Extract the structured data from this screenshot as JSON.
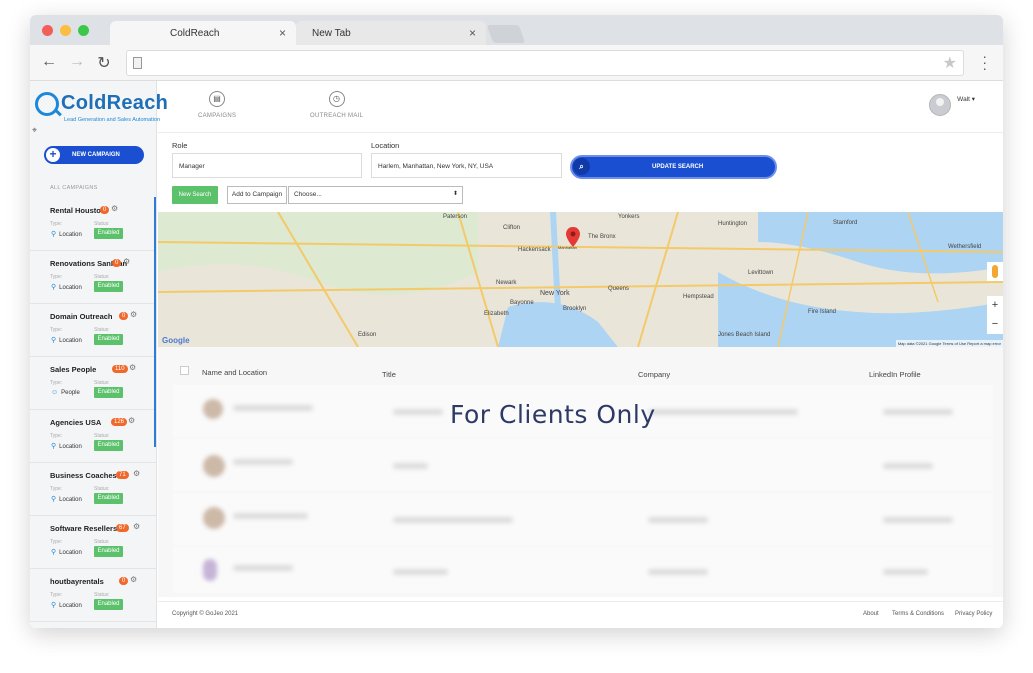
{
  "browser": {
    "tabs": [
      {
        "label": "ColdReach",
        "active": true
      },
      {
        "label": "New Tab",
        "active": false
      }
    ],
    "close_icon": "×",
    "nav": {
      "back": "←",
      "forward": "→",
      "reload": "↻"
    },
    "address": "",
    "star_icon": "bookmark-star-icon",
    "menu_icon": "kebab-menu-icon"
  },
  "app": {
    "logo": {
      "name": "ColdReach",
      "tagline": "Lead Generation and Sales Automation"
    },
    "new_campaign": "NEW CAMPAIGN",
    "all_campaigns": "ALL CAMPAIGNS",
    "campaigns": [
      {
        "name": "Rental Houston",
        "badge": "0",
        "type_label": "Type:",
        "status_label": "Status:",
        "type": "Location",
        "status": "Enabled"
      },
      {
        "name": "Renovations SanFran",
        "badge": "0",
        "type_label": "Type:",
        "status_label": "Status:",
        "type": "Location",
        "status": "Enabled"
      },
      {
        "name": "Domain Outreach",
        "badge": "0",
        "type_label": "Type:",
        "status_label": "Status:",
        "type": "Location",
        "status": "Enabled"
      },
      {
        "name": "Sales People",
        "badge": "110",
        "type_label": "Type:",
        "status_label": "Status:",
        "type": "People",
        "status": "Enabled"
      },
      {
        "name": "Agencies USA",
        "badge": "126",
        "type_label": "Type:",
        "status_label": "Status:",
        "type": "Location",
        "status": "Enabled"
      },
      {
        "name": "Business Coaches",
        "badge": "71",
        "type_label": "Type:",
        "status_label": "Status:",
        "type": "Location",
        "status": "Enabled"
      },
      {
        "name": "Software Resellers",
        "badge": "67",
        "type_label": "Type:",
        "status_label": "Status:",
        "type": "Location",
        "status": "Enabled"
      },
      {
        "name": "houtbayrentals",
        "badge": "0",
        "type_label": "Type:",
        "status_label": "Status:",
        "type": "Location",
        "status": "Enabled"
      }
    ],
    "topnav": [
      {
        "label": "CAMPAIGNS",
        "icon": "document-icon"
      },
      {
        "label": "OUTREACH MAIL",
        "icon": "clock-icon"
      }
    ],
    "user": "Walt ▾",
    "search": {
      "role_label": "Role",
      "role_value": "Manager",
      "location_label": "Location",
      "location_value": "Harlem, Manhattan, New York, NY, USA",
      "update_button": "UPDATE SEARCH",
      "new_search": "New Search",
      "add_to_campaign": "Add to Campaign",
      "choose": "Choose..."
    },
    "map": {
      "labels": [
        "Clifton",
        "Newark",
        "New York",
        "Elizabeth",
        "Yonkers",
        "Huntington",
        "Hempstead",
        "Jones Beach Island",
        "Fire Island",
        "Paterson",
        "Stamford",
        "Brooklyn",
        "Queens",
        "The Bronx",
        "Wethersfield",
        "Levittown",
        "Edison",
        "Bayonne",
        "Hackensack",
        "Manhattan"
      ],
      "google": "Google",
      "footer": "Map data ©2021 Google   Terms of Use   Report a map error",
      "zoom_in": "+",
      "zoom_out": "−"
    },
    "table": {
      "columns": [
        "Name and Location",
        "Title",
        "Company",
        "LinkedIn Profile"
      ]
    },
    "watermark": "For Clients Only",
    "footer": {
      "copyright": "Copyright © GoJeo 2021",
      "links": [
        "About",
        "Terms & Conditions",
        "Privacy Policy"
      ]
    },
    "colors": {
      "primary": "#1b4fd1",
      "success": "#5cc16b",
      "badge": "#f0692b",
      "brand": "#1e88d8"
    }
  }
}
